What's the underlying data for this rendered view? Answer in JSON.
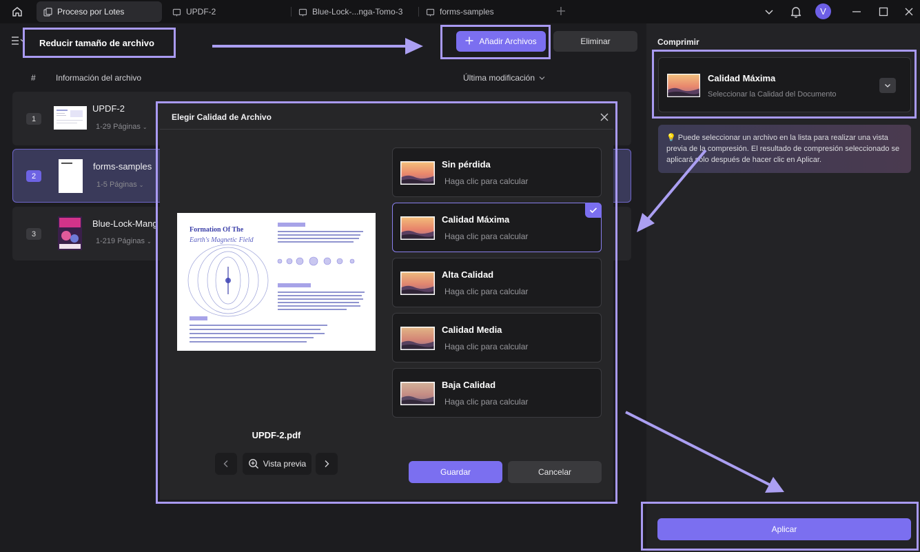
{
  "tabs": [
    {
      "label": "Proceso por Lotes",
      "active": true
    },
    {
      "label": "UPDF-2",
      "active": false
    },
    {
      "label": "Blue-Lock-...nga-Tomo-3",
      "active": false
    },
    {
      "label": "forms-samples",
      "active": false
    }
  ],
  "user": {
    "avatar_letter": "V"
  },
  "toolbar": {
    "title": "Reducir tamaño de archivo",
    "add_files_label": "Añadir Archivos",
    "delete_label": "Eliminar"
  },
  "list": {
    "col_number": "#",
    "col_info": "Información del archivo",
    "col_modified": "Última modificación",
    "rows": [
      {
        "num": "1",
        "name": "UPDF-2",
        "pages": "1-29 Páginas"
      },
      {
        "num": "2",
        "name": "forms-samples",
        "pages": "1-5 Páginas"
      },
      {
        "num": "3",
        "name": "Blue-Lock-Mang",
        "pages": "1-219 Páginas"
      }
    ]
  },
  "modal": {
    "title": "Elegir Calidad de Archivo",
    "file_name": "UPDF-2.pdf",
    "preview_label": "Vista previa",
    "save_label": "Guardar",
    "cancel_label": "Cancelar",
    "preview_doc": {
      "heading_line1": "Formation Of The",
      "heading_line2": "Earth's Magnetic Field"
    },
    "options": [
      {
        "title": "Sin pérdida",
        "subtitle": "Haga clic para calcular",
        "selected": false
      },
      {
        "title": "Calidad Máxima",
        "subtitle": "Haga clic para calcular",
        "selected": true
      },
      {
        "title": "Alta Calidad",
        "subtitle": "Haga clic para calcular",
        "selected": false
      },
      {
        "title": "Calidad Media",
        "subtitle": "Haga clic para calcular",
        "selected": false
      },
      {
        "title": "Baja Calidad",
        "subtitle": "Haga clic para calcular",
        "selected": false
      }
    ]
  },
  "right_panel": {
    "section_title": "Comprimir",
    "quality_title": "Calidad Máxima",
    "quality_subtitle": "Seleccionar la Calidad del Documento",
    "hint": "Puede seleccionar un archivo en la lista para realizar una vista previa de la compresión. El resultado de compresión seleccionado se aplicará solo después de hacer clic en Aplicar.",
    "apply_label": "Aplicar"
  },
  "colors": {
    "accent": "#7b6ff0",
    "highlight_frame": "#a99af2",
    "background": "#1c1c1f"
  }
}
